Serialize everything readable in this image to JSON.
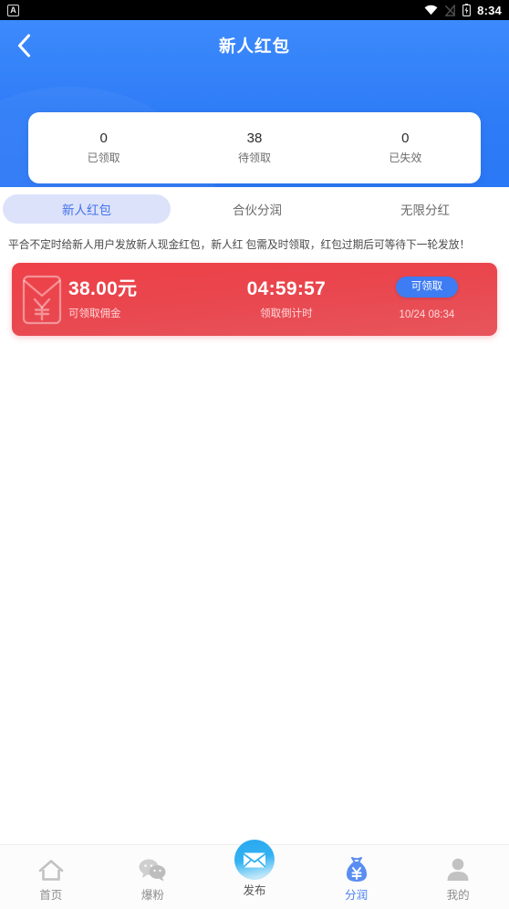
{
  "statusbar": {
    "notification_icon": "app-notification-icon",
    "wifi_icon": "wifi-icon",
    "signal_icon": "signal-off-icon",
    "battery_icon": "battery-icon",
    "time": "8:34"
  },
  "header": {
    "back_icon": "chevron-left-icon",
    "title": "新人红包",
    "accent_color": "#2f7cf7"
  },
  "stats": [
    {
      "value": "0",
      "label": "已领取"
    },
    {
      "value": "38",
      "label": "待领取"
    },
    {
      "value": "0",
      "label": "已失效"
    }
  ],
  "tabs": [
    {
      "label": "新人红包",
      "active": true
    },
    {
      "label": "合伙分润",
      "active": false
    },
    {
      "label": "无限分红",
      "active": false
    }
  ],
  "description": "平合不定时给新人用户发放新人现金红包，新人红 包需及时领取，红包过期后可等待下一轮发放！",
  "packets": [
    {
      "icon": "red-envelope-yuan-icon",
      "amount": "38.00元",
      "amount_label": "可领取佣金",
      "countdown": "04:59:57",
      "countdown_label": "领取倒计时",
      "action_label": "可领取",
      "date": "10/24 08:34",
      "card_color": "#e9464e",
      "action_color": "#3e7cf3"
    }
  ],
  "bottom_nav": [
    {
      "label": "首页",
      "icon": "home-icon",
      "active": false
    },
    {
      "label": "爆粉",
      "icon": "chat-bubbles-icon",
      "active": false
    },
    {
      "label": "发布",
      "icon": "envelope-circle-icon",
      "active": false
    },
    {
      "label": "分润",
      "icon": "money-bag-icon",
      "active": true
    },
    {
      "label": "我的",
      "icon": "person-icon",
      "active": false
    }
  ]
}
